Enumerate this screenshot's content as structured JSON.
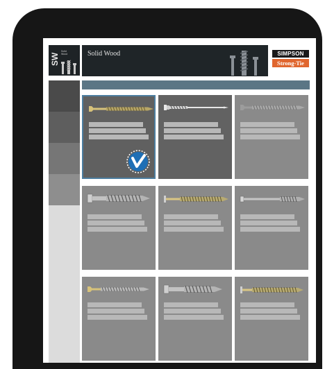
{
  "header": {
    "logo_abbr": "SW",
    "logo_sub_line1": "Solid",
    "logo_sub_line2": "Wood",
    "banner_title": "Solid Wood",
    "brand_top": "SIMPSON",
    "brand_bottom": "Strong-Tie"
  },
  "sidebar": {
    "items": [
      {
        "name": "category-1",
        "color": "#4a4a4a"
      },
      {
        "name": "category-2",
        "color": "#5e5e5e"
      },
      {
        "name": "category-3",
        "color": "#767676"
      },
      {
        "name": "category-4",
        "color": "#8e8e8e"
      }
    ]
  },
  "products": [
    {
      "screw": "flat-head-gold",
      "selected": true
    },
    {
      "screw": "hex-washer-long",
      "selected": false
    },
    {
      "screw": "flat-head-silver",
      "selected": false
    },
    {
      "screw": "hex-head-lag",
      "selected": false
    },
    {
      "screw": "flat-head-wafer",
      "selected": false
    },
    {
      "screw": "washer-head-long",
      "selected": false
    },
    {
      "screw": "flat-head-gold-short",
      "selected": false
    },
    {
      "screw": "hex-head-short",
      "selected": false
    },
    {
      "screw": "washer-head-short",
      "selected": false
    }
  ],
  "colors": {
    "accent": "#4d7ea0",
    "check_badge": "#1f6fb5",
    "brand_orange": "#e0662e"
  }
}
